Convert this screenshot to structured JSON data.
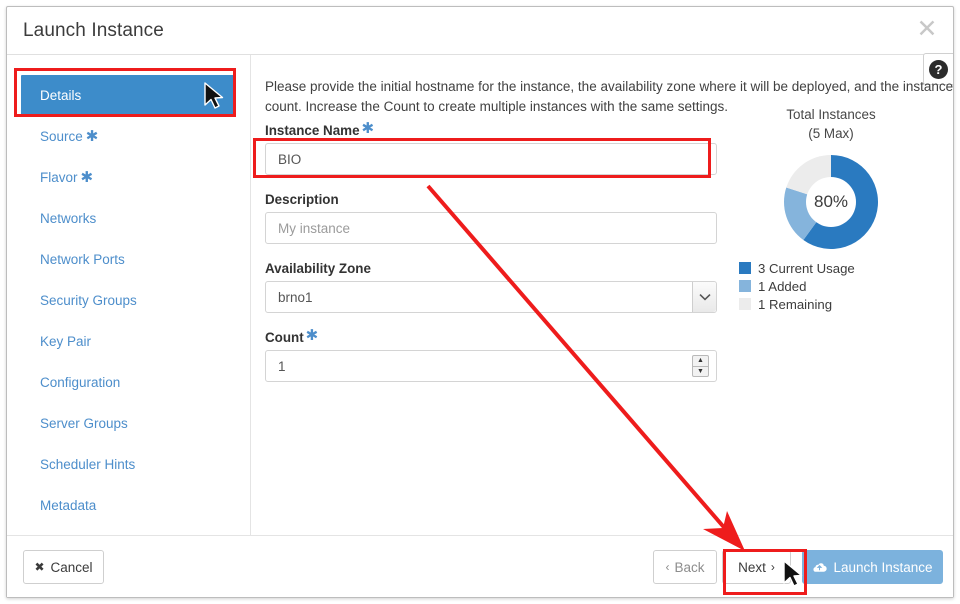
{
  "window": {
    "title": "Launch Instance",
    "close_icon": "close-icon",
    "help_icon": "help-icon",
    "help_label": "?"
  },
  "sidebar": {
    "items": [
      {
        "label": "Details",
        "required": false,
        "active": true
      },
      {
        "label": "Source",
        "required": true,
        "active": false
      },
      {
        "label": "Flavor",
        "required": true,
        "active": false
      },
      {
        "label": "Networks",
        "required": false,
        "active": false
      },
      {
        "label": "Network Ports",
        "required": false,
        "active": false
      },
      {
        "label": "Security Groups",
        "required": false,
        "active": false
      },
      {
        "label": "Key Pair",
        "required": false,
        "active": false
      },
      {
        "label": "Configuration",
        "required": false,
        "active": false
      },
      {
        "label": "Server Groups",
        "required": false,
        "active": false
      },
      {
        "label": "Scheduler Hints",
        "required": false,
        "active": false
      },
      {
        "label": "Metadata",
        "required": false,
        "active": false
      }
    ]
  },
  "main": {
    "intro": "Please provide the initial hostname for the instance, the availability zone where it will be deployed, and the instance count. Increase the Count to create multiple instances with the same settings.",
    "fields": {
      "instance_name": {
        "label": "Instance Name",
        "required_marker": "*",
        "value": "BIO",
        "placeholder": ""
      },
      "description": {
        "label": "Description",
        "required_marker": "",
        "value": "",
        "placeholder": "My instance"
      },
      "availability_zone": {
        "label": "Availability Zone",
        "required_marker": "",
        "value": "brno1",
        "options": [
          "brno1"
        ],
        "chevron_icon": "chevron-down-icon"
      },
      "count": {
        "label": "Count",
        "required_marker": "*",
        "value": "1",
        "spinner_up_icon": "caret-up-icon",
        "spinner_down_icon": "caret-down-icon"
      }
    }
  },
  "quota": {
    "title_line1": "Total Instances",
    "title_line2": "(5 Max)",
    "center_label": "80%"
  },
  "chart_data": {
    "type": "pie",
    "title": "Total Instances (5 Max)",
    "center_label": "80%",
    "total_max": 5,
    "categories": [
      "Current Usage",
      "Added",
      "Remaining"
    ],
    "values": [
      3,
      1,
      1
    ],
    "colors": [
      "#2a7ac0",
      "#85b4dc",
      "#ececec"
    ],
    "legend": [
      {
        "swatch": "#2a7ac0",
        "text": "3 Current Usage"
      },
      {
        "swatch": "#85b4dc",
        "text": "1 Added"
      },
      {
        "swatch": "#ececec",
        "text": "1 Remaining"
      }
    ],
    "legend_position": "below",
    "start_angle_deg": 0,
    "direction": "clockwise"
  },
  "footer": {
    "cancel": {
      "label": "Cancel",
      "icon": "x-mark-icon",
      "glyph": "✖"
    },
    "back": {
      "label": "Back",
      "icon": "chevron-left-icon",
      "glyph": "‹"
    },
    "next": {
      "label": "Next",
      "icon": "chevron-right-icon",
      "glyph": "›"
    },
    "launch": {
      "label": "Launch Instance",
      "icon": "cloud-upload-icon"
    }
  },
  "annotations": {
    "highlight_color": "#ee1c1c",
    "boxes": [
      "details-tab",
      "instance-name-field",
      "next-button"
    ],
    "arrow": {
      "from": "instance-name-field",
      "to": "next-button"
    },
    "cursors": [
      "details-tab",
      "next-button"
    ]
  }
}
